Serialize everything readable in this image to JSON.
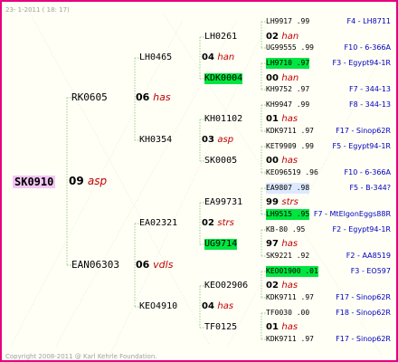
{
  "header": "23- 1-2011 ( 18: 17)",
  "footer": "Copyright 2008-2011 @ Karl Kehrle Foundation.",
  "colors": {
    "frame": "#e6007e",
    "line": "#a8d5a0",
    "breed": "#c00000",
    "ref": "#0000c0",
    "highlight": "#00e640"
  },
  "root": {
    "name": "SK0910",
    "year": "09",
    "breed": "asp"
  },
  "gen2": [
    {
      "name": "RK0605"
    },
    {
      "name": "EAN06303"
    }
  ],
  "gen2_breed": [
    {
      "year": "06",
      "breed": "has"
    },
    {
      "year": "06",
      "breed": "vdls"
    }
  ],
  "gen3": [
    {
      "name": "LH0465"
    },
    {
      "name": "KH0354"
    },
    {
      "name": "EA02321"
    },
    {
      "name": "KEO4910"
    }
  ],
  "gen3_breed": [
    {
      "year": "04",
      "breed": "han"
    },
    {
      "year": "03",
      "breed": "asp"
    },
    {
      "year": "02",
      "breed": "strs"
    },
    {
      "year": "04",
      "breed": "has"
    }
  ],
  "gen4": [
    {
      "name": "LH0261"
    },
    {
      "name": "KDK0004"
    },
    {
      "name": "KH01102"
    },
    {
      "name": "SK0005"
    },
    {
      "name": "EA99731"
    },
    {
      "name": "UG9714"
    },
    {
      "name": "KEO02906"
    },
    {
      "name": "TF0125"
    }
  ],
  "gen4_breed": [
    {
      "year": "02",
      "breed": "han"
    },
    {
      "year": "00",
      "breed": "han"
    },
    {
      "year": "01",
      "breed": "has"
    },
    {
      "year": "00",
      "breed": "has"
    },
    {
      "year": "99",
      "breed": "strs"
    },
    {
      "year": "97",
      "breed": "has"
    },
    {
      "year": "02",
      "breed": "has"
    },
    {
      "year": "01",
      "breed": "has"
    }
  ],
  "gen5": [
    {
      "name": "LH9917 .99",
      "ref": "F4 - LH8711"
    },
    {
      "name": "UG99555 .99",
      "ref": "F10 - 6-366A"
    },
    {
      "name": "LH9710 .97",
      "ref": "F3 - Egypt94-1R"
    },
    {
      "name": "KH9752 .97",
      "ref": "F7 - 344-13"
    },
    {
      "name": "KH9947 .99",
      "ref": "F8 - 344-13"
    },
    {
      "name": "KDK9711 .97",
      "ref": "F17 - Sinop62R"
    },
    {
      "name": "KET9909 .99",
      "ref": "F5 - Egypt94-1R"
    },
    {
      "name": "KEO96519 .96",
      "ref": "F10 - 6-366A"
    },
    {
      "name": "EA9807 .98",
      "ref": "F5 - B-344?"
    },
    {
      "name": "LH9515 .95",
      "ref": "F7 - MtElgonEggs88R"
    },
    {
      "name": "KB-80 .95",
      "ref": "F2 - Egypt94-1R"
    },
    {
      "name": "SK9221 .92",
      "ref": "F2 - AA8519"
    },
    {
      "name": "KEO01900 .01",
      "ref": "F3 - EO597"
    },
    {
      "name": "KDK9711 .97",
      "ref": "F17 - Sinop62R"
    },
    {
      "name": "TF0030 .00",
      "ref": "F18 - Sinop62R"
    },
    {
      "name": "KDK9711 .97",
      "ref": "F17 - Sinop62R"
    }
  ]
}
